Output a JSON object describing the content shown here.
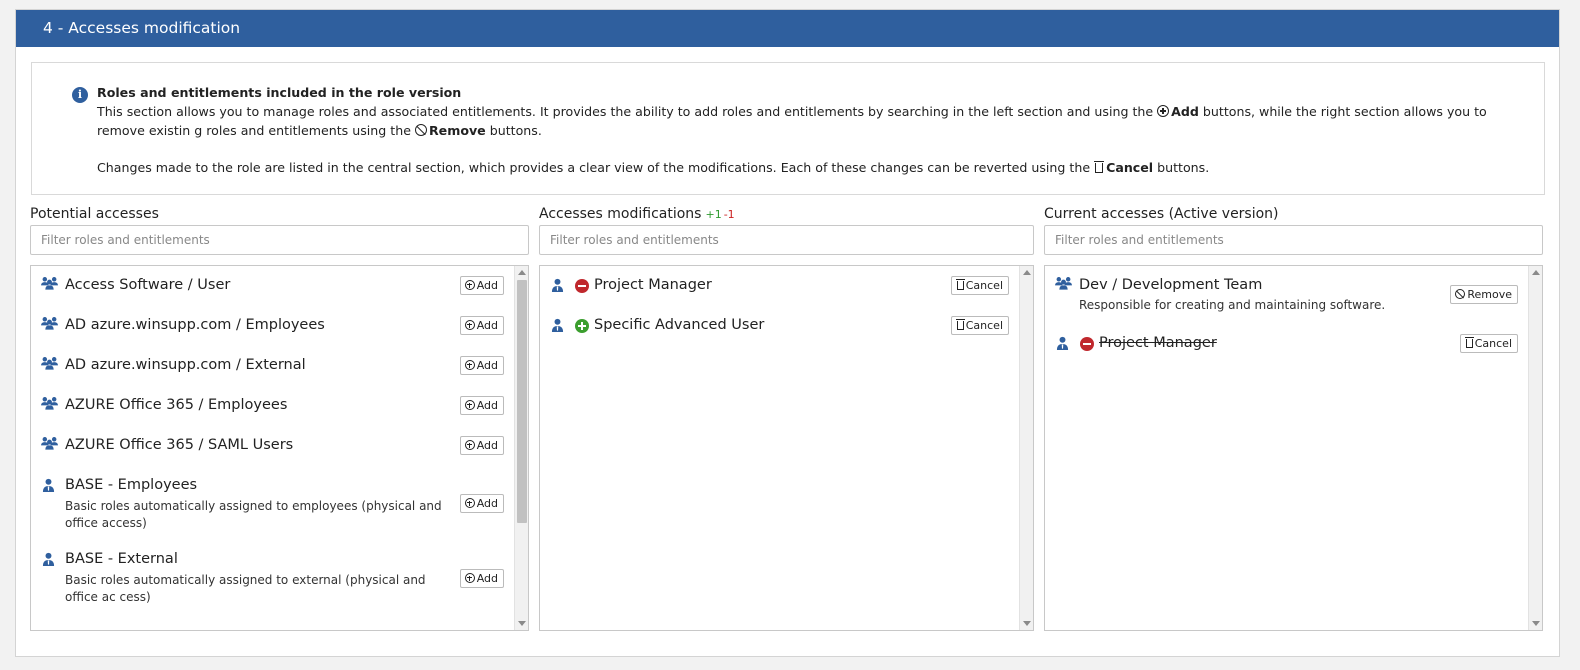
{
  "section": {
    "title": "4 - Accesses modification"
  },
  "info": {
    "title": "Roles and entitlements included in the role version",
    "p1_before_add": "This section allows you to manage roles and associated entitlements. It provides the ability to add roles and entitlements by searching in the left section and using the ",
    "add_label": "Add",
    "p1_middle": " buttons, while the right section allows you to remove existin g roles and entitlements using the ",
    "remove_label": "Remove",
    "p1_end": " buttons.",
    "p2_before": "Changes made to the role are listed in the central section, which provides a clear view of the modifications. Each of these changes can be reverted using the ",
    "cancel_label": "Cancel",
    "p2_end": " buttons."
  },
  "potential": {
    "title": "Potential accesses",
    "filter_placeholder": "Filter roles and entitlements",
    "items": [
      {
        "name": "Access Software / User",
        "icon": "group-icon",
        "button": "Add"
      },
      {
        "name": "AD azure.winsupp.com / Employees",
        "icon": "group-icon",
        "button": "Add"
      },
      {
        "name": "AD azure.winsupp.com / External",
        "icon": "group-icon",
        "button": "Add"
      },
      {
        "name": "AZURE Office 365 / Employees",
        "icon": "group-icon",
        "button": "Add"
      },
      {
        "name": "AZURE Office 365 / SAML Users",
        "icon": "group-icon",
        "button": "Add"
      },
      {
        "name": "BASE - Employees",
        "desc": "Basic roles automatically assigned to employees (physical and office access)",
        "icon": "person-role-icon",
        "button": "Add"
      },
      {
        "name": "BASE - External",
        "desc": "Basic roles automatically assigned to external (physical and office ac cess)",
        "icon": "person-role-icon",
        "button": "Add"
      }
    ]
  },
  "modifications": {
    "title": "Accesses modifications",
    "added_count": "+1",
    "removed_count": "-1",
    "filter_placeholder": "Filter roles and entitlements",
    "items": [
      {
        "name": "Project Manager",
        "change": "removed",
        "icon": "person-role-icon",
        "button": "Cancel"
      },
      {
        "name": "Specific Advanced User",
        "change": "added",
        "icon": "person-role-icon",
        "button": "Cancel"
      }
    ]
  },
  "current": {
    "title": "Current accesses (Active version)",
    "filter_placeholder": "Filter roles and entitlements",
    "items": [
      {
        "name": "Dev / Development Team",
        "desc": "Responsible for creating and maintaining software.",
        "icon": "group-icon",
        "button": "Remove"
      },
      {
        "name": "Project Manager",
        "change": "removed",
        "icon": "person-role-icon",
        "button": "Cancel"
      }
    ]
  },
  "colors": {
    "header": "#2f5f9e",
    "icon": "#2f5f9e",
    "added": "#3b9e2e",
    "removed": "#c0282d"
  }
}
